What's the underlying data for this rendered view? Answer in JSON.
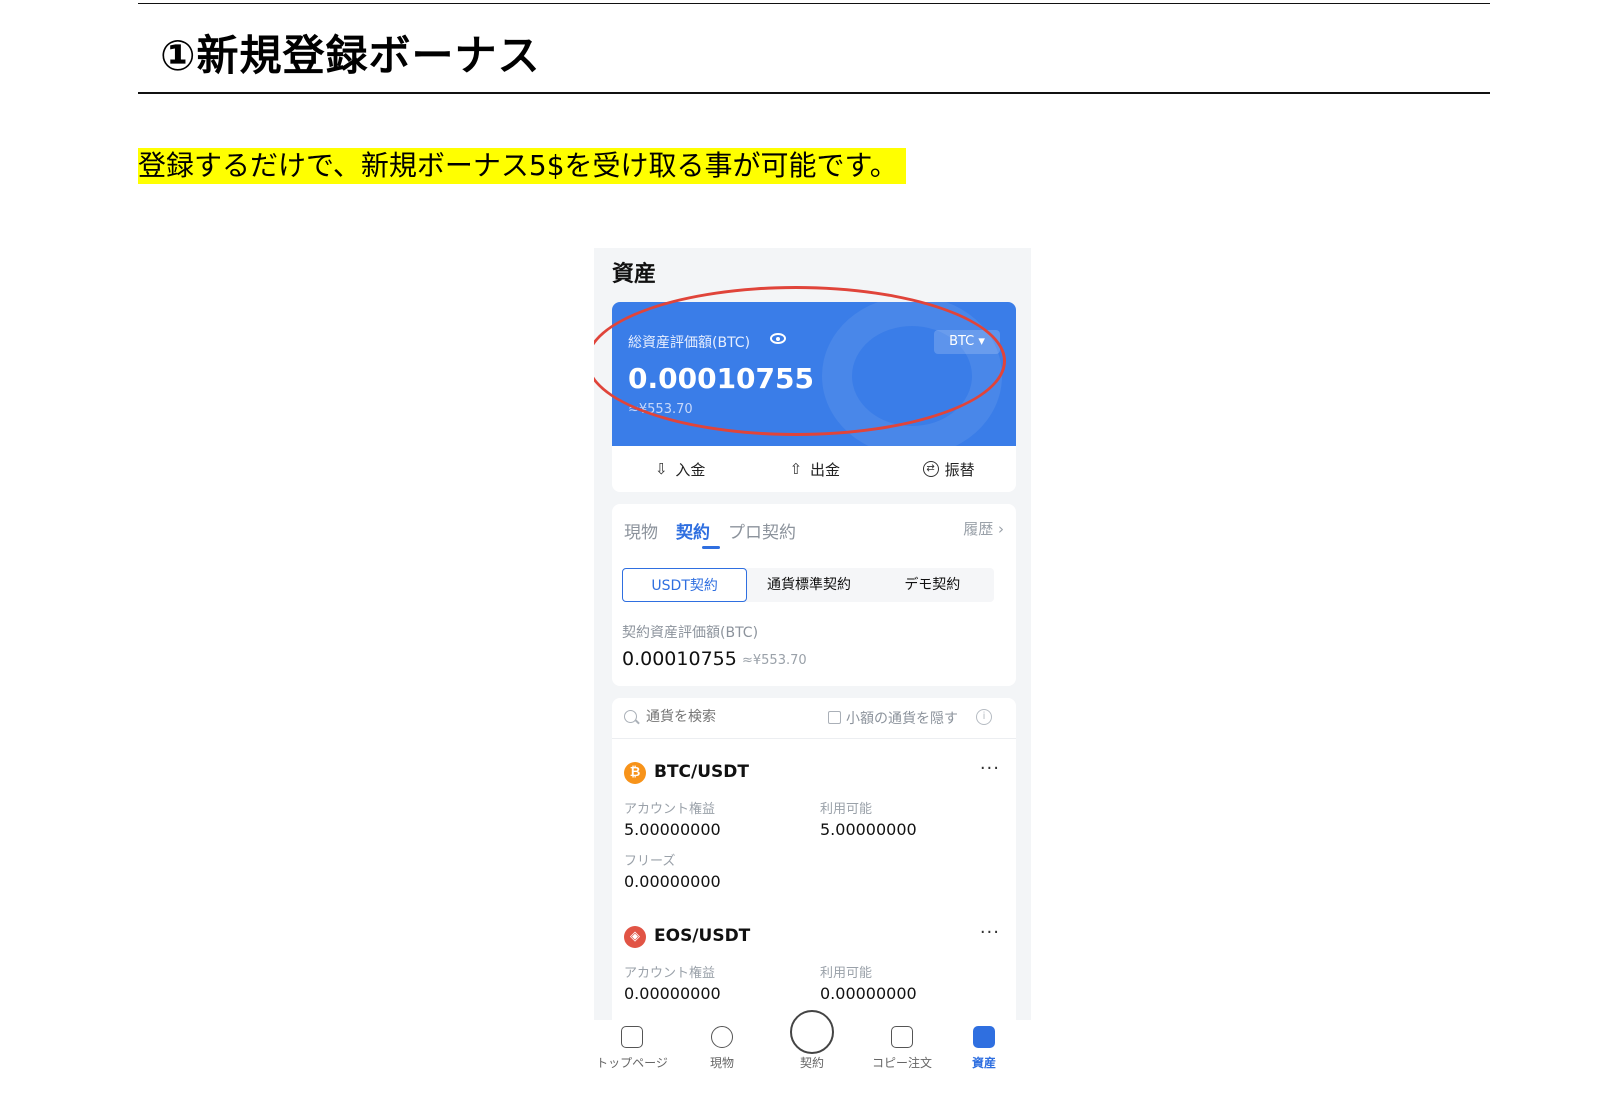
{
  "section": {
    "heading": "①新規登録ボーナス",
    "intro": "登録するだけで、新規ボーナス5$を受け取る事が可能です。"
  },
  "app": {
    "page_title": "資産",
    "balance_card": {
      "label": "総資産評価額(BTC)",
      "currency": "BTC ▾",
      "amount": "0.00010755",
      "fiat": "≈¥553.70"
    },
    "actions": [
      {
        "label": "入金",
        "icon": "deposit-icon"
      },
      {
        "label": "出金",
        "icon": "withdraw-icon"
      },
      {
        "label": "振替",
        "icon": "transfer-icon"
      }
    ],
    "tabs": {
      "spot": "現物",
      "contract": "契約",
      "pro": "プロ契約",
      "history": "履歴 ›"
    },
    "segments": [
      "USDT契約",
      "通貨標準契約",
      "デモ契約"
    ],
    "contract_asset": {
      "label": "契約資産評価額(BTC)",
      "value": "0.00010755",
      "fiat": "≈¥553.70"
    },
    "search": {
      "placeholder": "通貨を検索",
      "hide_small": "小額の通貨を隠す"
    },
    "coins": [
      {
        "name": "BTC/USDT",
        "icon_glyph": "₿",
        "color": "#f7931a",
        "equity_label": "アカウント権益",
        "equity": "5.00000000",
        "available_label": "利用可能",
        "available": "5.00000000",
        "frozen_label": "フリーズ",
        "frozen": "0.00000000"
      },
      {
        "name": "EOS/USDT",
        "icon_glyph": "◈",
        "color": "#e15445",
        "equity_label": "アカウント権益",
        "equity": "0.00000000",
        "available_label": "利用可能",
        "available": "0.00000000"
      }
    ],
    "nav": [
      "トップページ",
      "現物",
      "契約",
      "コピー注文",
      "資産"
    ],
    "colors": {
      "accent": "#2f6fe0",
      "card": "#3a7de8",
      "highlight": "#ffff00",
      "annotation": "#e0443a"
    }
  }
}
